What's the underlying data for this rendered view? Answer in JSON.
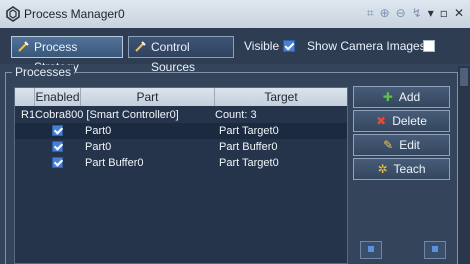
{
  "window": {
    "title": "Process Manager0"
  },
  "toolbar": {
    "process_strategy": "Process Strategy",
    "control_sources": "Control Sources",
    "visible_label": "Visible",
    "visible_checked": true,
    "show_camera_images_label": "Show Camera Images",
    "show_camera_images_checked": false
  },
  "processes": {
    "title": "Processes",
    "columns": [
      "Enabled",
      "Part",
      "Target"
    ],
    "group_row": {
      "controller": "R1Cobra800 [Smart Controller0]",
      "count": "Count: 3"
    },
    "rows": [
      {
        "enabled": true,
        "part": "Part0",
        "target": "Part Target0"
      },
      {
        "enabled": true,
        "part": "Part0",
        "target": "Part Buffer0"
      },
      {
        "enabled": true,
        "part": "Part Buffer0",
        "target": "Part Target0"
      }
    ]
  },
  "actions": {
    "add": "Add",
    "delete": "Delete",
    "edit": "Edit",
    "teach": "Teach"
  },
  "colors": {
    "accent": "#4b7fd1",
    "panel": "#34445a",
    "toolbar": "#2e3d52",
    "add_icon": "#5cc14a",
    "delete_icon": "#e24a3b"
  }
}
